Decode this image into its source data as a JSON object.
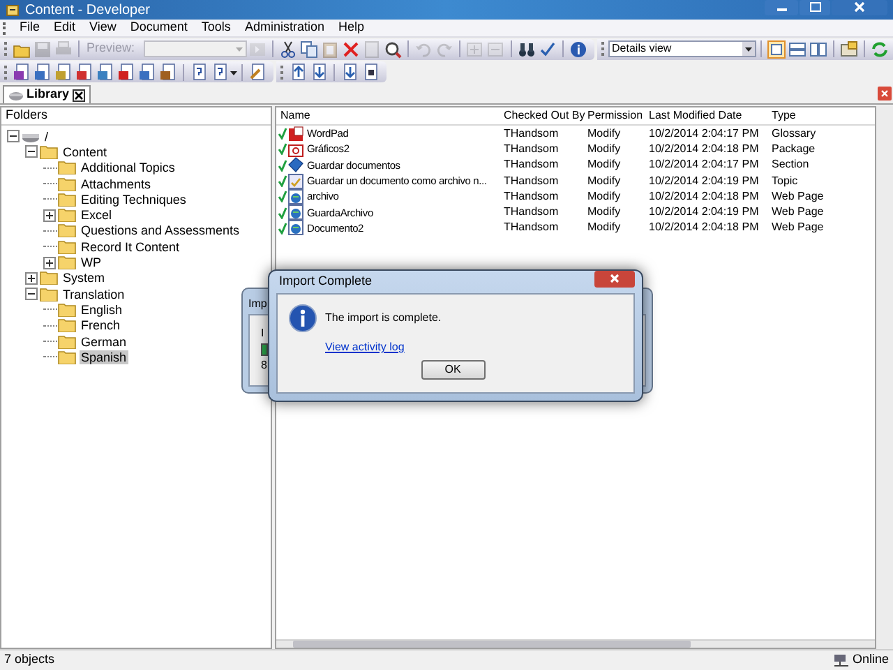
{
  "window": {
    "title": "Content - Developer"
  },
  "menu": [
    "File",
    "Edit",
    "View",
    "Document",
    "Tools",
    "Administration",
    "Help"
  ],
  "toolbar": {
    "preview_label": "Preview:",
    "view_select": "Details view"
  },
  "tabs": [
    {
      "label": "Library",
      "selected": true
    }
  ],
  "folders": {
    "header": "Folders",
    "tree": [
      {
        "label": "/",
        "kind": "drive",
        "expanded": true,
        "selected": false,
        "children": [
          {
            "label": "Content",
            "kind": "folder",
            "expanded": true,
            "selected": false,
            "children": [
              {
                "label": "Additional Topics",
                "kind": "folder",
                "selected": false
              },
              {
                "label": "Attachments",
                "kind": "folder",
                "selected": false
              },
              {
                "label": "Editing Techniques",
                "kind": "folder",
                "selected": false
              },
              {
                "label": "Excel",
                "kind": "folder",
                "expanded": false,
                "selected": false
              },
              {
                "label": "Questions and Assessments",
                "kind": "folder",
                "selected": false
              },
              {
                "label": "Record It Content",
                "kind": "folder",
                "selected": false
              },
              {
                "label": "WP",
                "kind": "folder",
                "expanded": false,
                "selected": false
              }
            ]
          },
          {
            "label": "System",
            "kind": "folder",
            "expanded": false,
            "selected": false
          },
          {
            "label": "Translation",
            "kind": "folder",
            "expanded": true,
            "selected": false,
            "children": [
              {
                "label": "English",
                "kind": "folder",
                "selected": false
              },
              {
                "label": "French",
                "kind": "folder",
                "selected": false
              },
              {
                "label": "German",
                "kind": "folder",
                "selected": false
              },
              {
                "label": "Spanish",
                "kind": "folder",
                "selected": true
              }
            ]
          }
        ]
      }
    ]
  },
  "list": {
    "columns": [
      "Name",
      "Checked Out By",
      "Permission",
      "Last Modified Date",
      "Type"
    ],
    "rows": [
      {
        "kind": "glossary",
        "name": "WordPad",
        "checked_out_by": "THandsom",
        "permission": "Modify",
        "last_modified": "10/2/2014 2:04:17 PM",
        "type": "Glossary"
      },
      {
        "kind": "package",
        "name": "Gráficos2",
        "checked_out_by": "THandsom",
        "permission": "Modify",
        "last_modified": "10/2/2014 2:04:18 PM",
        "type": "Package"
      },
      {
        "kind": "section",
        "name": "Guardar documentos",
        "checked_out_by": "THandsom",
        "permission": "Modify",
        "last_modified": "10/2/2014 2:04:17 PM",
        "type": "Section"
      },
      {
        "kind": "topic",
        "name": "Guardar un documento como archivo n...",
        "checked_out_by": "THandsom",
        "permission": "Modify",
        "last_modified": "10/2/2014 2:04:19 PM",
        "type": "Topic"
      },
      {
        "kind": "webpage",
        "name": "archivo",
        "checked_out_by": "THandsom",
        "permission": "Modify",
        "last_modified": "10/2/2014 2:04:18 PM",
        "type": "Web Page"
      },
      {
        "kind": "webpage",
        "name": "GuardaArchivo",
        "checked_out_by": "THandsom",
        "permission": "Modify",
        "last_modified": "10/2/2014 2:04:19 PM",
        "type": "Web Page"
      },
      {
        "kind": "webpage",
        "name": "Documento2",
        "checked_out_by": "THandsom",
        "permission": "Modify",
        "last_modified": "10/2/2014 2:04:18 PM",
        "type": "Web Page"
      }
    ]
  },
  "background_dialog": {
    "title": "Imp",
    "label": "I",
    "value": "8"
  },
  "dialog": {
    "title": "Import Complete",
    "message": "The import is complete.",
    "link": "View activity log",
    "buttons": [
      "OK"
    ]
  },
  "status_bar": {
    "count": "7 objects",
    "connection": "Online"
  }
}
